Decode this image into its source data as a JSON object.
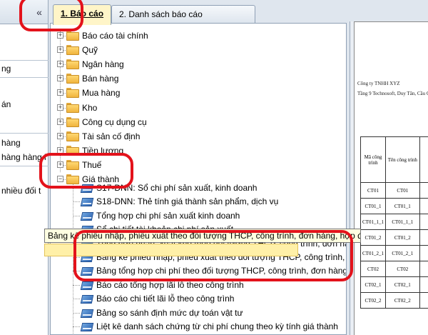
{
  "left_panel": {
    "collapse_label": "«",
    "items": [
      "ng",
      "án",
      "hàng",
      "hàng hàng l",
      "nhiều đối t"
    ]
  },
  "tabs": [
    {
      "label": "1. Báo cáo",
      "active": true
    },
    {
      "label": "2. Danh sách báo cáo",
      "active": false
    }
  ],
  "tree": {
    "folders": [
      "Báo cáo tài chính",
      "Quỹ",
      "Ngân hàng",
      "Bán hàng",
      "Mua hàng",
      "Kho",
      "Công cụ dụng cụ",
      "Tài sản cố định",
      "Tiền lương",
      "Thuế",
      "Giá thành"
    ],
    "reports": [
      "S17-DNN: Sổ chi phí sản xuất, kinh doanh",
      "S18-DNN: Thẻ tính giá thành sản phẩm, dịch vụ",
      "Tổng hợp chi phí sản xuất kinh doanh",
      "Sổ chi tiết tài khoản chi phí sản xuất",
      "Tổng hợp nhập, xuất kho theo đối tượng THCP, công trình, đơn hàng,",
      "Bảng kê phiếu nhập, phiếu xuất theo đối tượng THCP, công trình, đơn hàng, hợp đồng",
      "Bảng tổng hợp chi phí theo đối tượng THCP, công trình, đơn hàng, hợp",
      "Báo cáo tổng hợp lãi lỗ theo công trình",
      "Báo cáo chi tiết lãi lỗ theo công trình",
      "Bảng so sánh định mức dự toán vật tư",
      "Liệt kê danh sách chứng từ chi phí chung theo kỳ tính giá thành"
    ]
  },
  "tooltip": "Bảng kê phiếu nhập, phiếu xuất theo đối tượng THCP, công trình, đơn hàng, hợp đồng",
  "preview": {
    "company": "Công ty TNHH XYZ",
    "address": "Tầng 9 Technosoft, Duy Tân, Cầu G",
    "col1_header": "Mã công trình",
    "col2_header": "Tên công trình",
    "rows": [
      [
        "CT01",
        "CT01"
      ],
      [
        "CT01_1",
        "CT01_1"
      ],
      [
        "CT01_1_1",
        "CT01_1_1"
      ],
      [
        "CT01_2",
        "CT01_2"
      ],
      [
        "CT01_2_1",
        "CT01_2_1"
      ],
      [
        "CT02",
        "CT02"
      ],
      [
        "CT02_1",
        "CT02_1"
      ],
      [
        "CT02_2",
        "CT02_2"
      ]
    ]
  },
  "colors": {
    "annotation": "#e3121b",
    "active_tab": "#fff5c8",
    "tooltip_bg": "#ffffe1",
    "selected_row": "#fff0a8"
  }
}
